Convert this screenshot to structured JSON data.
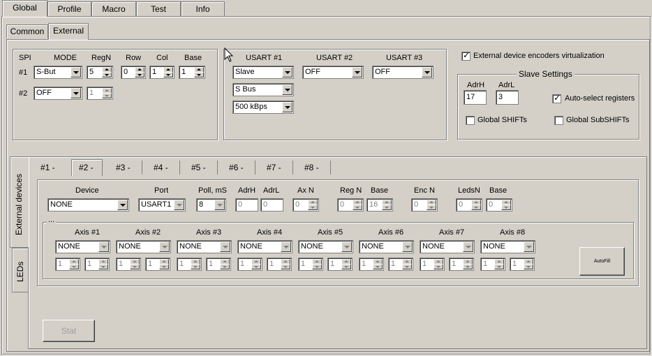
{
  "main_tabs": [
    "Global",
    "Profile",
    "Macro",
    "Test",
    "Info"
  ],
  "sub_tabs": [
    "Common",
    "External"
  ],
  "spi": {
    "header": "SPI",
    "columns": [
      "MODE",
      "RegN",
      "Row",
      "Col",
      "Base"
    ],
    "row1": {
      "label": "#1",
      "mode": "S-But",
      "regn": "5",
      "row": "0",
      "col": "1",
      "base": "1"
    },
    "row2": {
      "label": "#2",
      "mode": "OFF",
      "regn": "1"
    }
  },
  "usart": {
    "headers": [
      "USART #1",
      "USART #2",
      "USART #3"
    ],
    "u1_mode": "Slave",
    "u1_bus": "S Bus",
    "u1_speed": "500 kBps",
    "u2_mode": "OFF",
    "u3_mode": "OFF"
  },
  "virtualization": {
    "label": "External device encoders virtualization",
    "checked": true
  },
  "slave_settings": {
    "title": "Slave Settings",
    "adrh_label": "AdrH",
    "adrh_value": "17",
    "adrl_label": "AdrL",
    "adrl_value": "3",
    "auto_select_label": "Auto-select registers",
    "auto_select_checked": true,
    "global_shifts_label": "Global SHIFTs",
    "global_subshifts_label": "Global SubSHIFTs"
  },
  "side_tabs": [
    "External devices",
    "LEDs"
  ],
  "device_tabs": [
    "#1 -",
    "#2 -",
    "#3 -",
    "#4 -",
    "#5 -",
    "#6 -",
    "#7 -",
    "#8 -"
  ],
  "device": {
    "labels": {
      "device": "Device",
      "port": "Port",
      "poll": "Poll, mS",
      "adrh": "AdrH",
      "adrl": "AdrL",
      "axn": "Ax N",
      "regn": "Reg N",
      "base": "Base",
      "encn": "Enc N",
      "ledsn": "LedsN",
      "base2": "Base"
    },
    "device": "NONE",
    "port": "USART1",
    "poll": "8",
    "adrh": "0",
    "adrl": "0",
    "axn": "0",
    "regn": "0",
    "base": "16",
    "encn": "0",
    "ledsn": "0",
    "base2": "0"
  },
  "axes_group_label": "...",
  "axes": [
    {
      "label": "Axis #1",
      "value": "NONE",
      "a": "1",
      "b": "1"
    },
    {
      "label": "Axis #2",
      "value": "NONE",
      "a": "1",
      "b": "1"
    },
    {
      "label": "Axis #3",
      "value": "NONE",
      "a": "1",
      "b": "1"
    },
    {
      "label": "Axis #4",
      "value": "NONE",
      "a": "1",
      "b": "1"
    },
    {
      "label": "Axis #5",
      "value": "NONE",
      "a": "1",
      "b": "1"
    },
    {
      "label": "Axis #6",
      "value": "NONE",
      "a": "1",
      "b": "1"
    },
    {
      "label": "Axis #7",
      "value": "NONE",
      "a": "1",
      "b": "1"
    },
    {
      "label": "Axis #8",
      "value": "NONE",
      "a": "1",
      "b": "1"
    }
  ],
  "autofill_label": "AutoFill",
  "stat_label": "Stat"
}
